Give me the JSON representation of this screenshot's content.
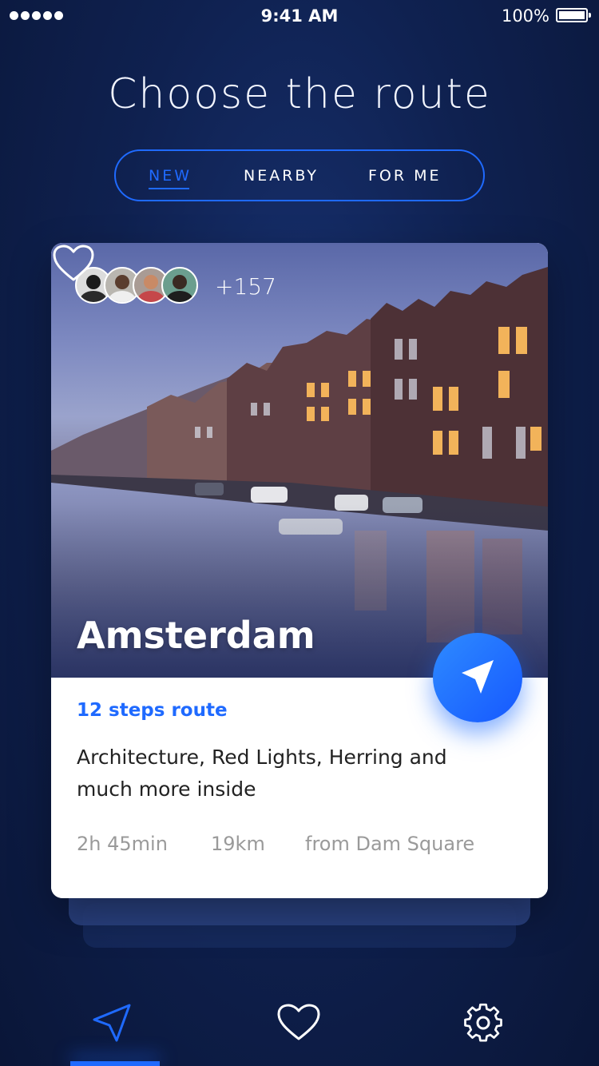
{
  "status_bar": {
    "time": "9:41 AM",
    "battery": "100%"
  },
  "header": {
    "title": "Choose the route"
  },
  "tabs": [
    {
      "label": "NEW",
      "active": true
    },
    {
      "label": "NEARBY",
      "active": false
    },
    {
      "label": "FOR ME",
      "active": false
    }
  ],
  "card": {
    "followers_extra": "+157",
    "city": "Amsterdam",
    "steps_label": "12 steps route",
    "description": "Architecture, Red Lights, Herring and much more inside",
    "duration": "2h 45min",
    "distance": "19km",
    "start": "from Dam Square",
    "favorite_icon": "heart-outline-icon",
    "go_icon": "navigation-arrow-icon"
  },
  "bottom_nav": [
    {
      "icon": "navigation-arrow-icon",
      "active": true
    },
    {
      "icon": "heart-icon",
      "active": false
    },
    {
      "icon": "gear-icon",
      "active": false
    }
  ],
  "colors": {
    "accent": "#1f6aff",
    "background": "#0f2150"
  }
}
